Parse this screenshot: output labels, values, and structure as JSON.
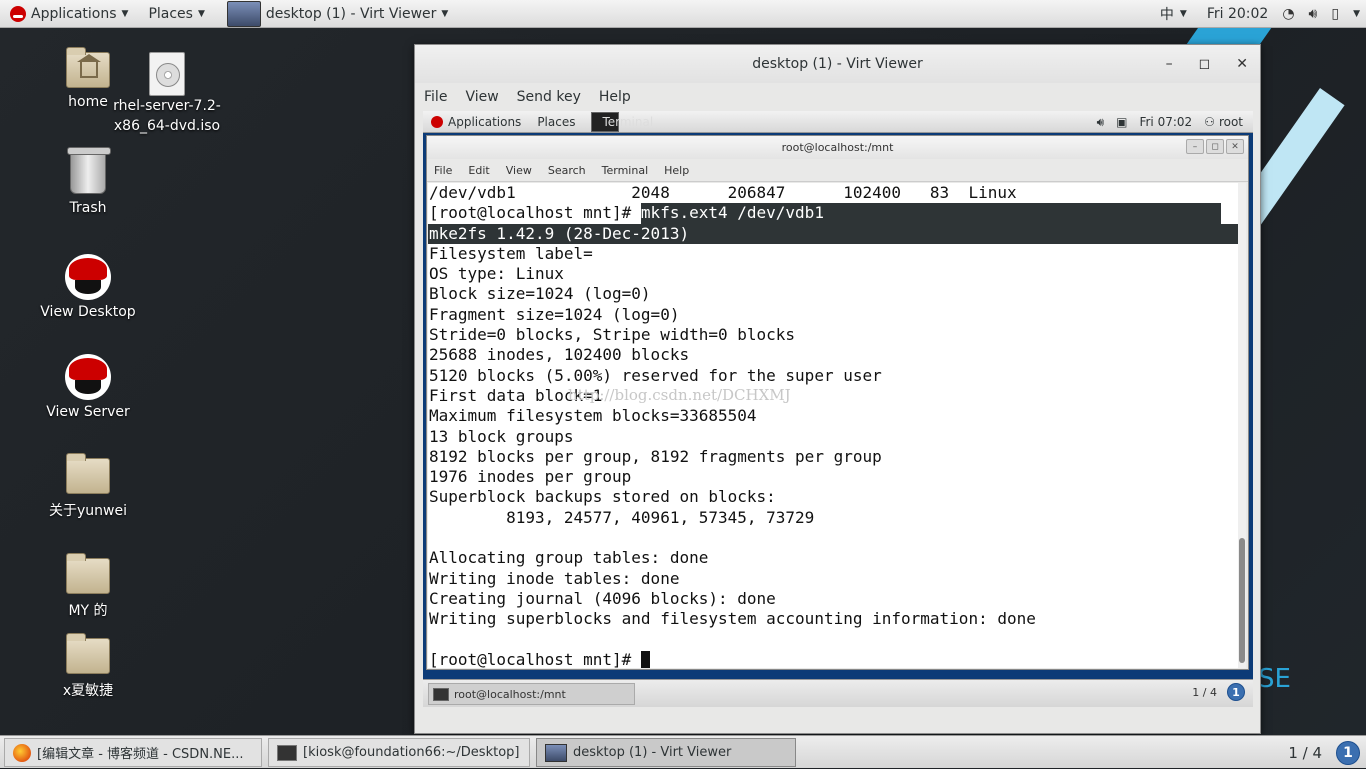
{
  "topbar": {
    "applications": "Applications",
    "places": "Places",
    "window_title": "desktop (1) - Virt Viewer",
    "input_method": "中",
    "clock": "Fri 20:02"
  },
  "desktop_icons": {
    "home": "home",
    "iso": "rhel-server-7.2-x86_64-dvd.iso",
    "trash": "Trash",
    "view_desktop": "View Desktop",
    "view_server": "View Server",
    "folder_yunwei": "关于yunwei",
    "folder_my": "MY 的",
    "folder_x": "x夏敏捷"
  },
  "background_text": "SE",
  "virt_viewer": {
    "title": "desktop (1) - Virt Viewer",
    "menu": [
      "File",
      "View",
      "Send key",
      "Help"
    ],
    "controls": {
      "minimize": "–",
      "maximize": "◻",
      "close": "✕"
    }
  },
  "guest": {
    "topbar": {
      "applications": "Applications",
      "places": "Places",
      "terminal_label": "Terminal",
      "clock": "Fri 07:02",
      "user": "root"
    },
    "terminal": {
      "title": "root@localhost:/mnt",
      "menu": [
        "File",
        "Edit",
        "View",
        "Search",
        "Terminal",
        "Help"
      ],
      "lines": [
        "/dev/vdb1            2048      206847      102400   83  Linux",
        "[root@localhost mnt]# ",
        "mke2fs 1.42.9 (28-Dec-2013)",
        "Filesystem label=",
        "OS type: Linux",
        "Block size=1024 (log=0)",
        "Fragment size=1024 (log=0)",
        "Stride=0 blocks, Stripe width=0 blocks",
        "25688 inodes, 102400 blocks",
        "5120 blocks (5.00%) reserved for the super user",
        "First data block=1",
        "Maximum filesystem blocks=33685504",
        "13 block groups",
        "8192 blocks per group, 8192 fragments per group",
        "1976 inodes per group",
        "Superblock backups stored on blocks:",
        "        8193, 24577, 40961, 57345, 73729",
        "",
        "Allocating group tables: done",
        "Writing inode tables: done",
        "Creating journal (4096 blocks): done",
        "Writing superblocks and filesystem accounting information: done",
        "",
        "[root@localhost mnt]# "
      ],
      "selected_command": "mkfs.ext4 /dev/vdb1",
      "watermark": "http://blog.csdn.net/DCHXMJ"
    },
    "bottombar": {
      "task": "root@localhost:/mnt",
      "pager": "1 / 4",
      "info": "1"
    }
  },
  "taskbar": {
    "tasks": [
      "[编辑文章 - 博客频道 - CSDN.NE...",
      "[kiosk@foundation66:~/Desktop]",
      "desktop (1) - Virt Viewer"
    ],
    "pager": "1 / 4",
    "info": "1"
  }
}
